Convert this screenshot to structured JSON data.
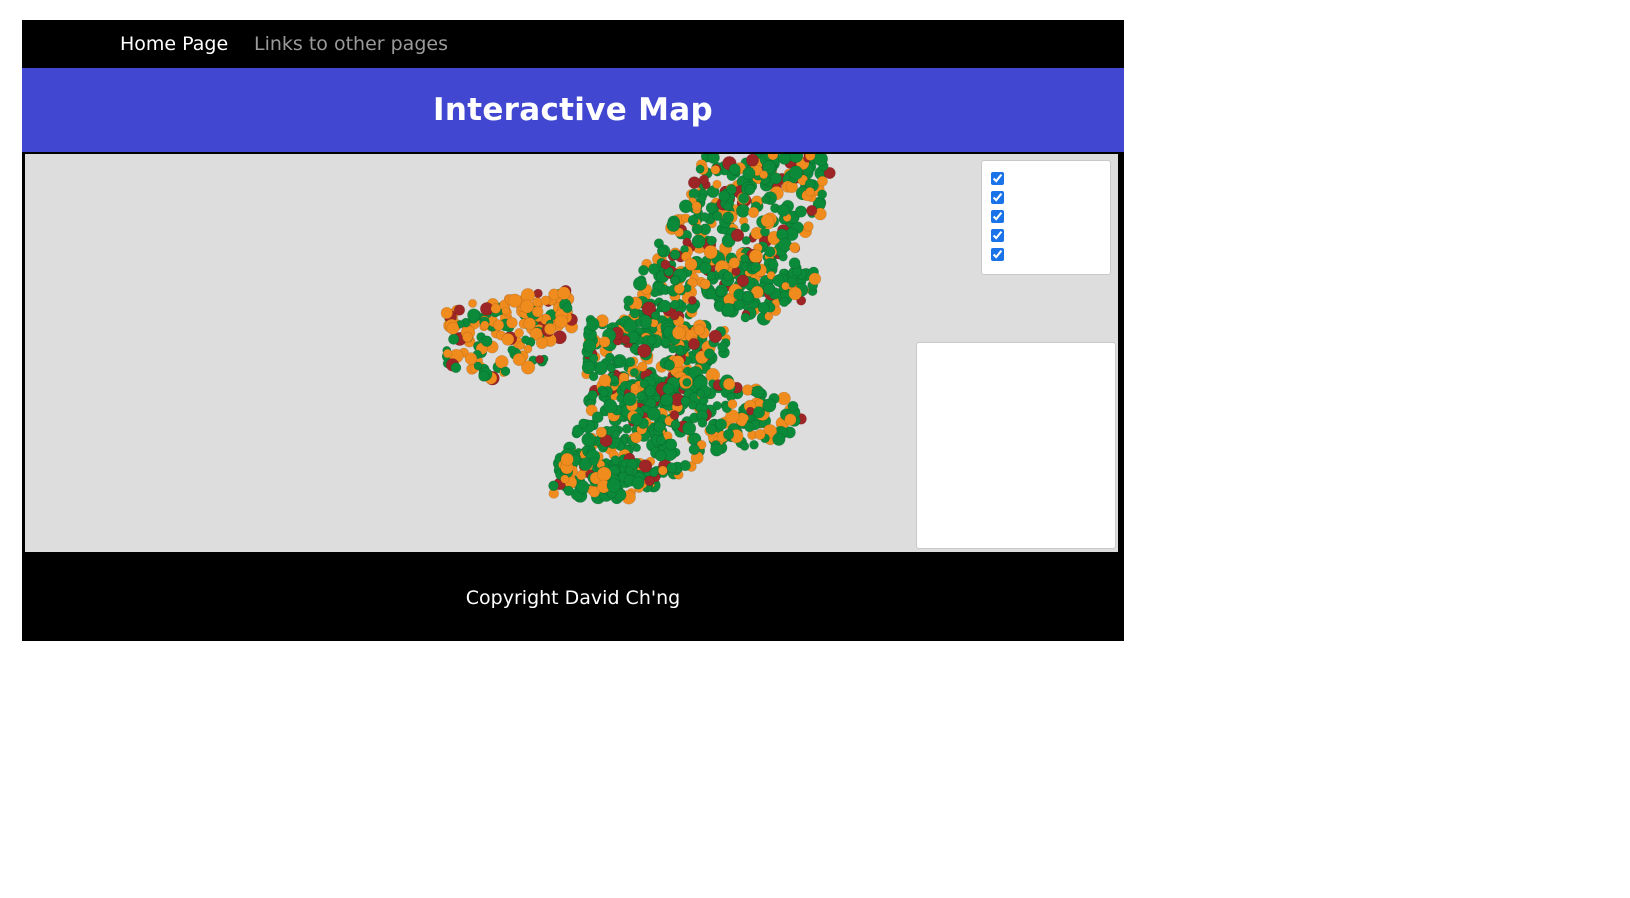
{
  "nav": {
    "home_label": "Home Page",
    "links_label": "Links to other pages"
  },
  "header": {
    "title": "Interactive Map"
  },
  "map": {
    "layers": [
      {
        "checked": true
      },
      {
        "checked": true
      },
      {
        "checked": true
      },
      {
        "checked": true
      },
      {
        "checked": true
      }
    ],
    "info_panel_text": "",
    "colors": {
      "background": "#dddddd",
      "green": "#0b8a3a",
      "orange": "#f08c1e",
      "red": "#9e2525"
    }
  },
  "footer": {
    "copyright": "Copyright David Ch'ng"
  },
  "colors": {
    "header_bg": "#4147d0",
    "nav_bg": "#000000",
    "footer_bg": "#000000"
  }
}
